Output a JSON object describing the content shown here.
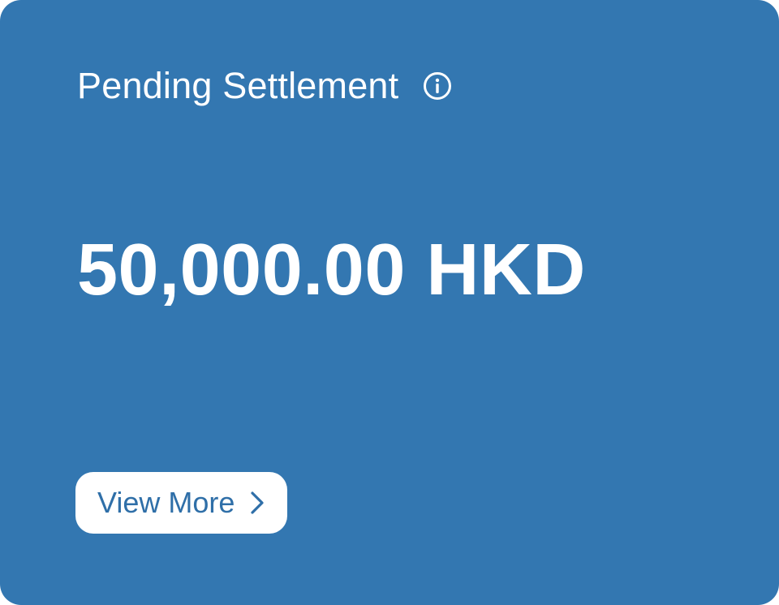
{
  "card": {
    "title": "Pending Settlement",
    "amount": "50,000.00 HKD",
    "view_more_label": "View More",
    "info_icon": "info-circle-icon",
    "chevron_icon": "chevron-right-icon"
  },
  "colors": {
    "card_background": "#3377b1",
    "text_on_card": "#ffffff",
    "button_background": "#ffffff",
    "button_text": "#2f6fa8"
  }
}
